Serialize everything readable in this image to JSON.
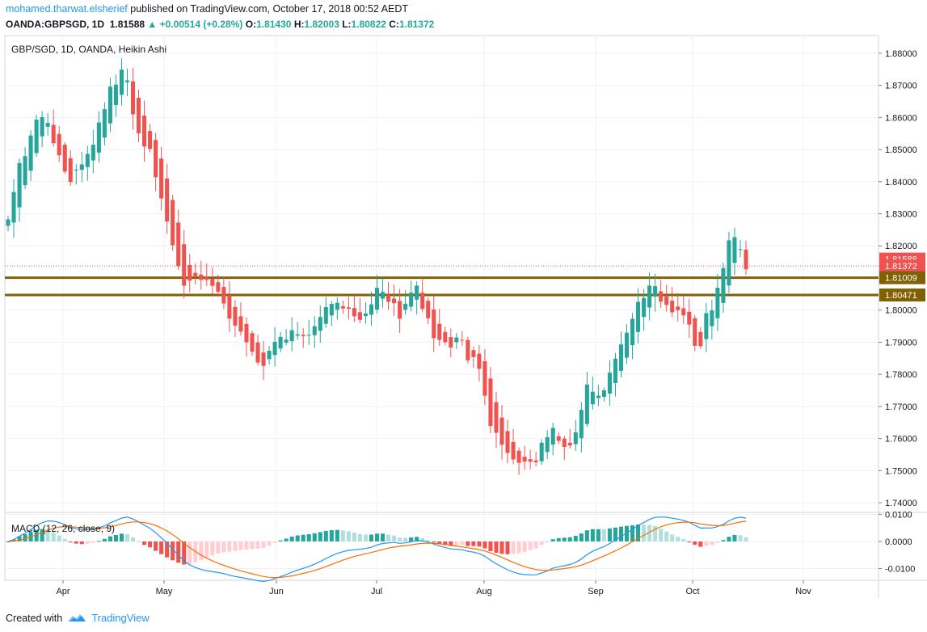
{
  "header": {
    "author": "mohamed.tharwat.elsherief",
    "published_text": "published on TradingView.com, October 17, 2018 00:52 AEDT",
    "symbol": "OANDA:GBPSGD, 1D",
    "last": "1.81588",
    "change": "▲ +0.00514 (+0.28%)",
    "o_label": "O:",
    "o_value": "1.81430",
    "h_label": "H:",
    "h_value": "1.82003",
    "l_label": "L:",
    "l_value": "1.80822",
    "c_label": "C:",
    "c_value": "1.81372"
  },
  "footer": {
    "created_with": "Created with",
    "brand": "TradingView"
  },
  "colors": {
    "up": "#26a69a",
    "down": "#ef5350",
    "up_light": "#b2dfdb",
    "down_light": "#ffcdd2",
    "level_line": "#806000",
    "macd_line": "#2196f3",
    "signal_line": "#ff6d00",
    "grid": "#eef0f3",
    "axis": "#787b86"
  },
  "chart_data": [
    {
      "type": "candlestick",
      "title": "GBP/SGD, 1D, OANDA, Heikin Ashi",
      "ylim": [
        1.737,
        1.8855
      ],
      "y_ticks": [
        "1.88000",
        "1.87000",
        "1.86000",
        "1.85000",
        "1.84000",
        "1.83000",
        "1.82000",
        "1.80000",
        "1.79000",
        "1.78000",
        "1.77000",
        "1.76000",
        "1.75000",
        "1.74000"
      ],
      "x_labels": [
        "Apr",
        "May",
        "Jun",
        "Jul",
        "Aug",
        "Sep",
        "Oct",
        "Nov"
      ],
      "price_labels": [
        {
          "text": "1.81588",
          "value": 1.81588,
          "color": "#ef5350"
        },
        {
          "text": "1.81372",
          "value": 1.81372,
          "color": "#ef5350"
        },
        {
          "text": "1.81009",
          "value": 1.81009,
          "color": "#806000"
        },
        {
          "text": "1.80471",
          "value": 1.80471,
          "color": "#806000"
        }
      ],
      "horizontal_levels": [
        1.81009,
        1.80471
      ],
      "last_price_line": 1.81372,
      "candle_count": 131,
      "waypoints": [
        {
          "i": 0,
          "c": 1.83
        },
        {
          "i": 4,
          "c": 1.845
        },
        {
          "i": 10,
          "c": 1.862
        },
        {
          "i": 15,
          "c": 1.85
        },
        {
          "i": 19,
          "c": 1.84
        },
        {
          "i": 25,
          "c": 1.848
        },
        {
          "i": 31,
          "c": 1.866
        },
        {
          "i": 36,
          "c": 1.878
        },
        {
          "i": 40,
          "c": 1.855
        },
        {
          "i": 44,
          "c": 1.85
        },
        {
          "i": 50,
          "c": 1.825
        },
        {
          "i": 54,
          "c": 1.808
        },
        {
          "i": 58,
          "c": 1.811
        },
        {
          "i": 64,
          "c": 1.808
        },
        {
          "i": 71,
          "c": 1.793
        },
        {
          "i": 79,
          "c": 1.783
        },
        {
          "i": 85,
          "c": 1.792
        },
        {
          "i": 94,
          "c": 1.792
        },
        {
          "i": 102,
          "c": 1.804
        },
        {
          "i": 109,
          "c": 1.797
        },
        {
          "i": 116,
          "c": 1.807
        },
        {
          "i": 122,
          "c": 1.799
        },
        {
          "i": 127,
          "c": 1.807
        },
        {
          "i": 133,
          "c": 1.79
        },
        {
          "i": 141,
          "c": 1.79
        },
        {
          "i": 146,
          "c": 1.78
        },
        {
          "i": 151,
          "c": 1.761
        },
        {
          "i": 158,
          "c": 1.752
        },
        {
          "i": 163,
          "c": 1.752
        },
        {
          "i": 169,
          "c": 1.762
        },
        {
          "i": 175,
          "c": 1.757
        },
        {
          "i": 180,
          "c": 1.777
        },
        {
          "i": 184,
          "c": 1.772
        },
        {
          "i": 190,
          "c": 1.79
        },
        {
          "i": 197,
          "c": 1.804
        },
        {
          "i": 200,
          "c": 1.808
        },
        {
          "i": 205,
          "c": 1.798
        },
        {
          "i": 210,
          "c": 1.8
        },
        {
          "i": 214,
          "c": 1.787
        },
        {
          "i": 220,
          "c": 1.808
        },
        {
          "i": 225,
          "c": 1.823
        },
        {
          "i": 229,
          "c": 1.813
        }
      ]
    },
    {
      "type": "macd",
      "title": "MACD (12, 26, close, 9)",
      "ylim": [
        -0.0143,
        0.0107
      ],
      "y_ticks": [
        "0.0100",
        "0.0000",
        "-0.0100"
      ],
      "series": [
        {
          "name": "MACD",
          "color": "#2196f3"
        },
        {
          "name": "Signal",
          "color": "#ff6d00"
        },
        {
          "name": "Histogram",
          "color": "#26a69a"
        }
      ]
    }
  ]
}
